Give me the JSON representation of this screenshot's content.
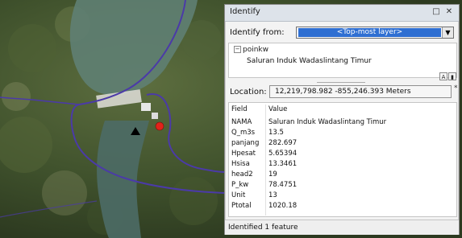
{
  "colors": {
    "selection": "#2f6fd2",
    "feature_marker": "#e2231a",
    "map_line": "#4b3aa8"
  },
  "window": {
    "title": "Identify",
    "minimize_icon": "restore-icon",
    "close_icon": "close-icon"
  },
  "identify_from": {
    "label": "Identify from:",
    "selected": "<Top-most layer>"
  },
  "tree": {
    "layer": "poinkw",
    "feature": "Saluran Induk Wadaslintang Timur"
  },
  "location": {
    "label": "Location:",
    "value": "12,219,798.982  -855,246.393 Meters"
  },
  "attributes": {
    "header": {
      "field": "Field",
      "value": "Value"
    },
    "rows": [
      {
        "field": "NAMA",
        "value": "Saluran Induk Wadaslintang Timur"
      },
      {
        "field": "Q_m3s",
        "value": "13.5"
      },
      {
        "field": "panjang",
        "value": "282.697"
      },
      {
        "field": "Hpesat",
        "value": "5.65394"
      },
      {
        "field": "Hsisa",
        "value": "13.3461"
      },
      {
        "field": "head2",
        "value": "19"
      },
      {
        "field": "P_kw",
        "value": "78.4751"
      },
      {
        "field": "Unit",
        "value": "13"
      },
      {
        "field": "Ptotal",
        "value": "1020.18"
      }
    ]
  },
  "status": "Identified 1 feature"
}
